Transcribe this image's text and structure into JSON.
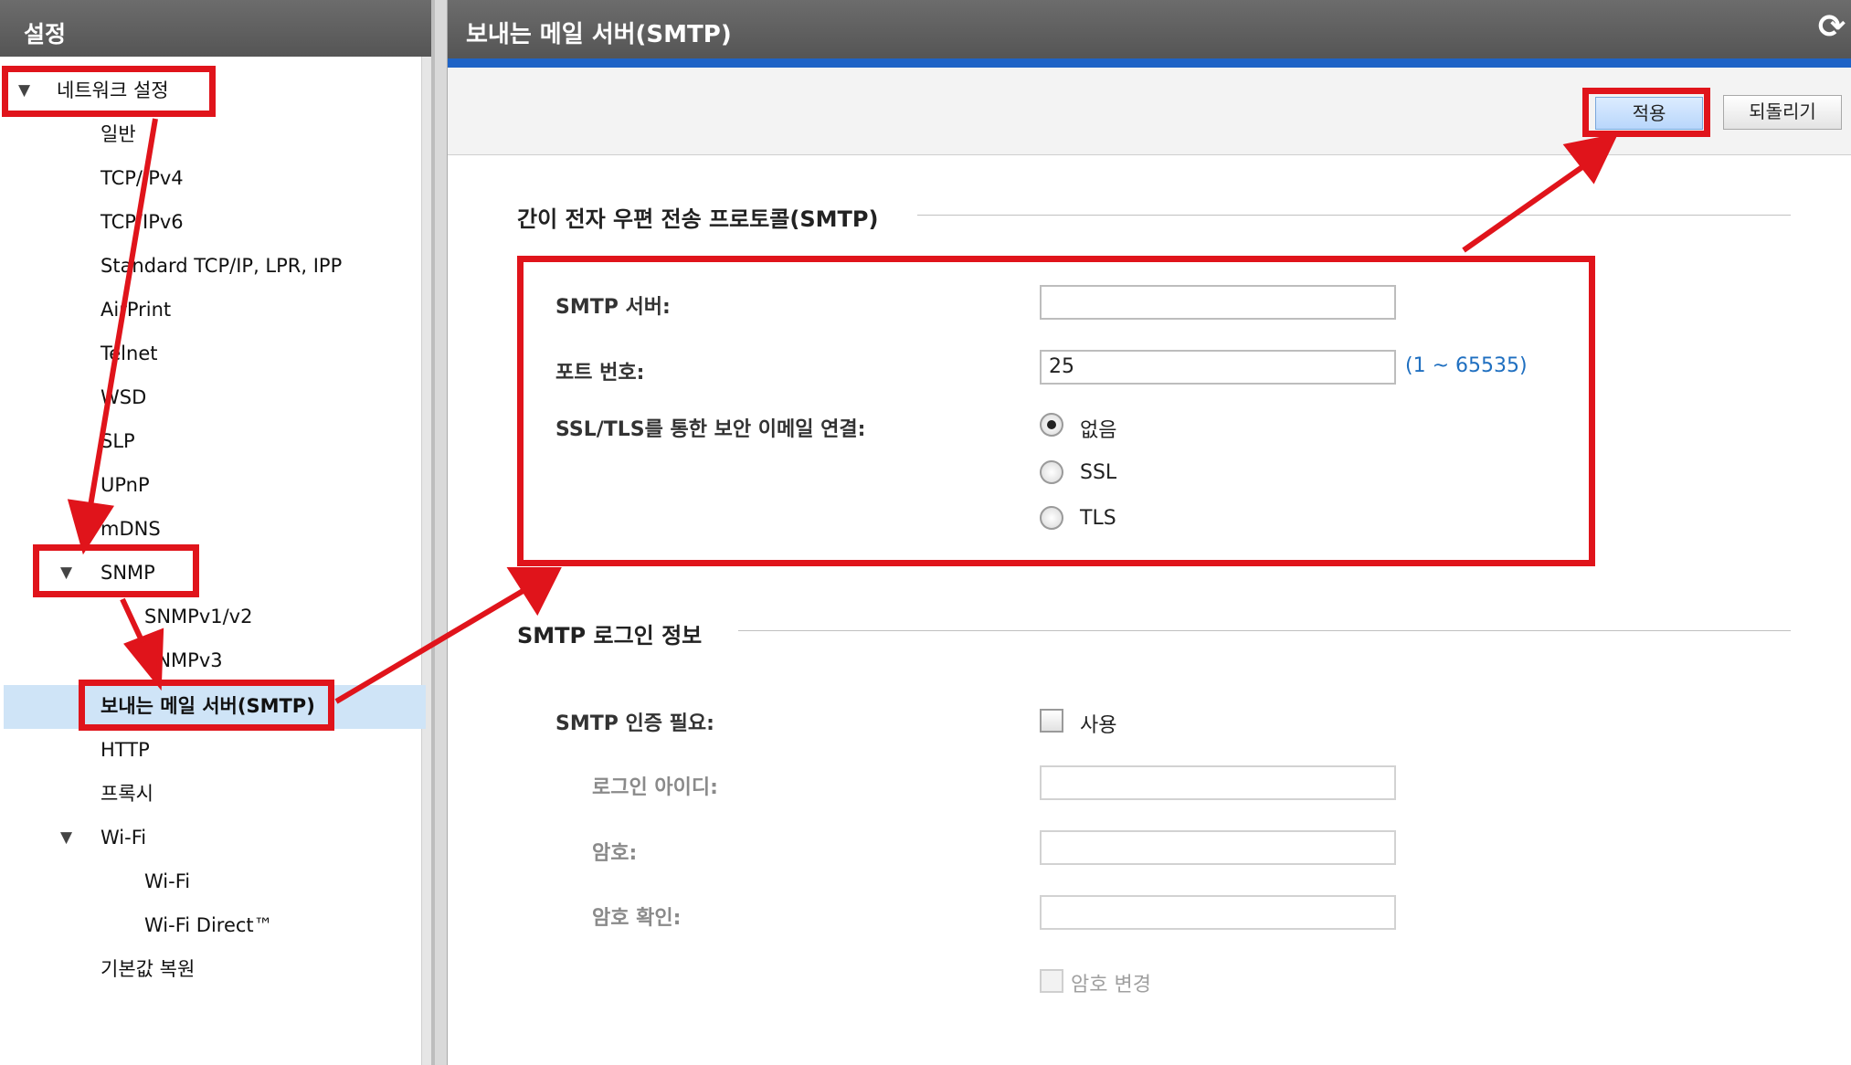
{
  "left_panel": {
    "title": "설정",
    "tree": [
      {
        "label": "네트워크 설정",
        "expanded": true
      },
      {
        "label": "일반"
      },
      {
        "label": "TCP/IPv4"
      },
      {
        "label": "TCP/IPv6"
      },
      {
        "label": "Standard TCP/IP, LPR, IPP"
      },
      {
        "label": "AirPrint"
      },
      {
        "label": "Telnet"
      },
      {
        "label": "WSD"
      },
      {
        "label": "SLP"
      },
      {
        "label": "UPnP"
      },
      {
        "label": "mDNS"
      },
      {
        "label": "SNMP",
        "expanded": true
      },
      {
        "label": "SNMPv1/v2"
      },
      {
        "label": "SNMPv3"
      },
      {
        "label": "보내는 메일 서버(SMTP)",
        "selected": true
      },
      {
        "label": "HTTP"
      },
      {
        "label": "프록시"
      },
      {
        "label": "Wi-Fi",
        "expanded": true
      },
      {
        "label": "Wi-Fi"
      },
      {
        "label": "Wi-Fi Direct™"
      },
      {
        "label": "기본값 복원"
      }
    ]
  },
  "right_panel": {
    "title": "보내는 메일 서버(SMTP)",
    "refresh_icon": "refresh-icon",
    "toolbar": {
      "apply_label": "적용",
      "revert_label": "되돌리기"
    },
    "smtp_section": {
      "title": "간이 전자 우편 전송 프로토콜(SMTP)",
      "server_label": "SMTP 서버:",
      "server_value": "",
      "port_label": "포트 번호:",
      "port_value": "25",
      "port_range": "(1 ~ 65535)",
      "ssl_label": "SSL/TLS를 통한 보안 이메일 연결:",
      "ssl_options": [
        "없음",
        "SSL",
        "TLS"
      ],
      "ssl_selected": "없음"
    },
    "login_section": {
      "title": "SMTP 로그인 정보",
      "auth_label": "SMTP 인증 필요:",
      "auth_checkbox_label": "사용",
      "auth_checked": false,
      "login_id_label": "로그인 아이디:",
      "login_id_value": "",
      "password_label": "암호:",
      "password_value": "",
      "password_confirm_label": "암호 확인:",
      "password_confirm_value": "",
      "change_password_label": "암호 변경"
    }
  },
  "annotation_color": "#e0141b"
}
